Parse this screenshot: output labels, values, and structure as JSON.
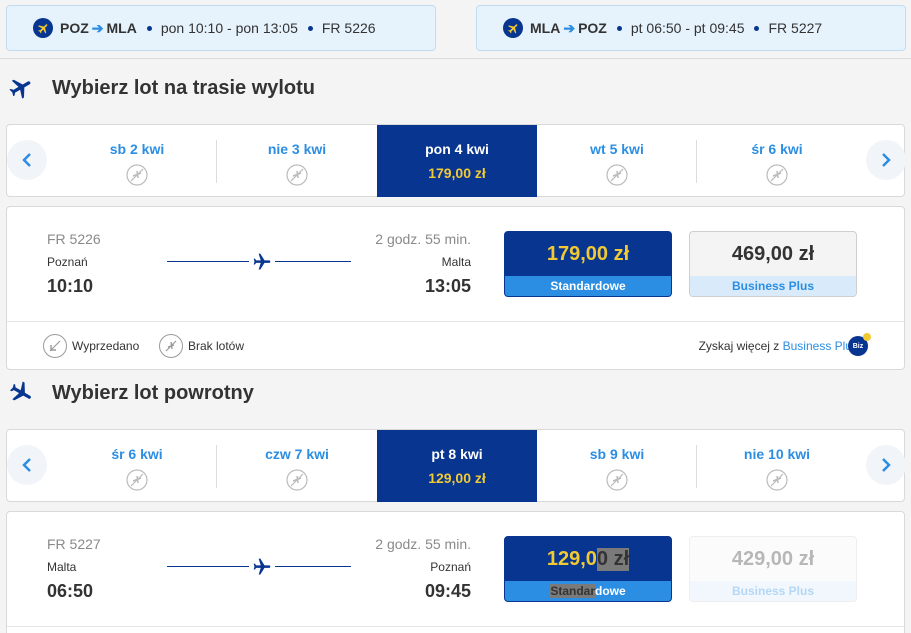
{
  "outbound_chip": {
    "from": "POZ",
    "to": "MLA",
    "times": "pon 10:10 - pon 13:05",
    "flight": "FR 5226"
  },
  "return_chip": {
    "from": "MLA",
    "to": "POZ",
    "times": "pt 06:50 - pt 09:45",
    "flight": "FR 5227"
  },
  "outbound": {
    "title": "Wybierz lot na trasie wylotu",
    "days": [
      {
        "label": "sb 2 kwi"
      },
      {
        "label": "nie 3 kwi"
      },
      {
        "label": "pon 4 kwi",
        "price": "179,00 zł"
      },
      {
        "label": "wt 5 kwi"
      },
      {
        "label": "śr 6 kwi"
      }
    ],
    "flight": {
      "number": "FR 5226",
      "duration": "2 godz. 55 min.",
      "origin": "Poznań",
      "destination": "Malta",
      "depart": "10:10",
      "arrive": "13:05",
      "standard_price": "179,00 zł",
      "standard_label": "Standardowe",
      "business_price": "469,00 zł",
      "business_label": "Business Plus"
    },
    "legend": {
      "sold_out": "Wyprzedano",
      "no_flights": "Brak lotów",
      "promo_text": "Zyskaj więcej z",
      "promo_link": "Business Plus",
      "badge": "Biz"
    }
  },
  "return": {
    "title": "Wybierz lot powrotny",
    "days": [
      {
        "label": "śr 6 kwi"
      },
      {
        "label": "czw 7 kwi"
      },
      {
        "label": "pt 8 kwi",
        "price": "129,00 zł"
      },
      {
        "label": "sb 9 kwi"
      },
      {
        "label": "nie 10 kwi"
      }
    ],
    "flight": {
      "number": "FR 5227",
      "duration": "2 godz. 55 min.",
      "origin": "Malta",
      "destination": "Poznań",
      "depart": "06:50",
      "arrive": "09:45",
      "standard_price_a": "129,0",
      "standard_price_b": "0 zł",
      "standard_label_a": "Standar",
      "standard_label_b": "dowe",
      "business_price": "429,00 zł",
      "business_label": "Business Plus"
    }
  },
  "colors": {
    "navy": "#073590",
    "blue": "#2b8ee3",
    "yellow": "#f1c933"
  }
}
